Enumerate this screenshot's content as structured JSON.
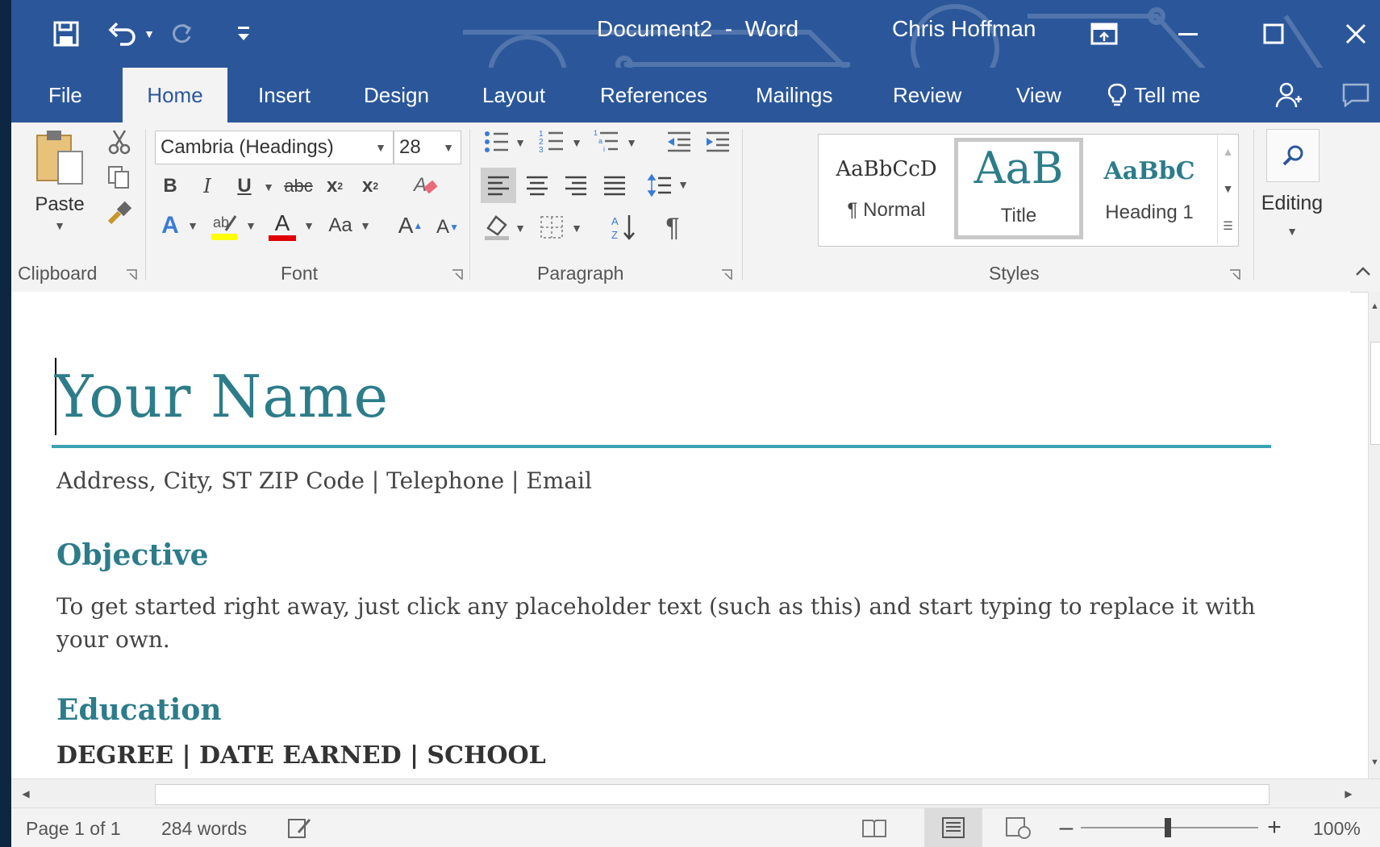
{
  "window": {
    "title": "Document2  -  Word",
    "user": "Chris Hoffman"
  },
  "tabs": [
    {
      "label": "File"
    },
    {
      "label": "Home"
    },
    {
      "label": "Insert"
    },
    {
      "label": "Design"
    },
    {
      "label": "Layout"
    },
    {
      "label": "References"
    },
    {
      "label": "Mailings"
    },
    {
      "label": "Review"
    },
    {
      "label": "View"
    },
    {
      "label": "Tell me"
    }
  ],
  "ribbon": {
    "clipboard": {
      "label": "Clipboard",
      "paste": "Paste"
    },
    "font": {
      "label": "Font",
      "font_name": "Cambria (Headings)",
      "font_size": "28",
      "bold": "B",
      "italic": "I",
      "underline": "U",
      "strike": "abc",
      "subscript": "x",
      "superscript": "x",
      "case": "Aa",
      "grow": "A",
      "shrink": "A",
      "effects": "A",
      "color": "A"
    },
    "paragraph": {
      "label": "Paragraph",
      "pilcrow": "¶"
    },
    "styles": {
      "label": "Styles",
      "items": [
        {
          "preview": "AaBbCcD",
          "name": "¶ Normal"
        },
        {
          "preview": "AaB",
          "name": "Title"
        },
        {
          "preview": "AaBbC",
          "name": "Heading 1"
        }
      ]
    },
    "editing": {
      "label": "Editing"
    }
  },
  "document": {
    "name": "Your Name",
    "contact": "Address, City, ST ZIP Code | Telephone | Email",
    "objective_heading": "Objective",
    "objective_text": "To get started right away, just click any placeholder text (such as this) and start typing to replace it with your own.",
    "education_heading": "Education",
    "degree_line": "DEGREE | DATE EARNED | SCHOOL"
  },
  "status": {
    "page": "Page 1 of 1",
    "words": "284 words",
    "zoom": "100%"
  },
  "colors": {
    "accent": "#2b579a",
    "heading": "#2d7c8a",
    "rule": "#3aa3b3"
  }
}
